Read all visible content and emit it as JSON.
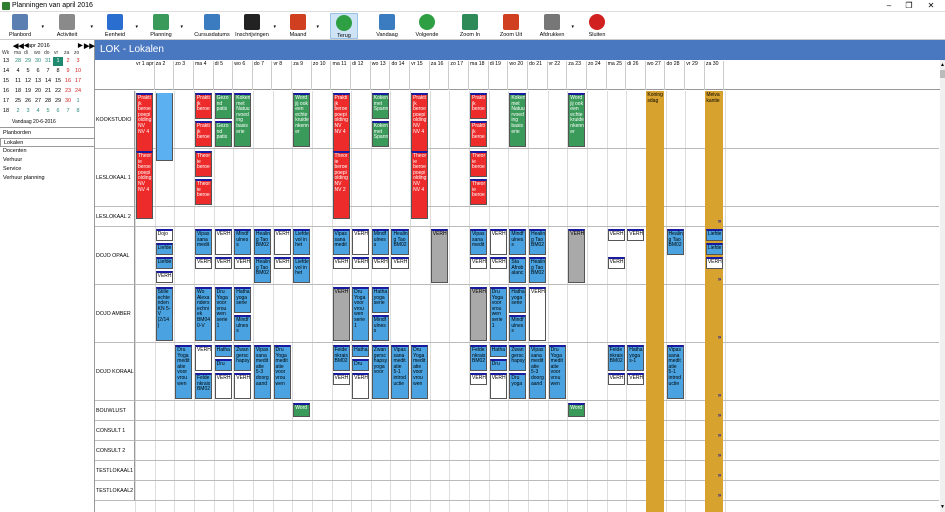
{
  "window": {
    "title": "Planningen van april 2016",
    "min": "–",
    "max": "❐",
    "close": "✕"
  },
  "toolbar": [
    {
      "label": "Planbord",
      "icon": "monitor-icon",
      "color": "#5a7fb0",
      "dd": true
    },
    {
      "label": "Activiteit",
      "icon": "gears-icon",
      "color": "#8a8a8a",
      "dd": true
    },
    {
      "label": "Eenheid",
      "icon": "cube-icon",
      "color": "#2a6fd0",
      "dd": true
    },
    {
      "label": "Planning",
      "icon": "chart-icon",
      "color": "#3a9a5a",
      "dd": true
    },
    {
      "label": "Cursusdatums",
      "icon": "calendar-grid-icon",
      "color": "#3b7bbf",
      "dd": false
    },
    {
      "label": "Inschrijvingen",
      "icon": "film-icon",
      "color": "#222222",
      "dd": true
    },
    {
      "label": "Maand",
      "icon": "calendar-icon",
      "color": "#d04020",
      "dd": true
    },
    {
      "label": "Terug",
      "icon": "back-arrow-icon",
      "color": "#2ea043",
      "dd": false
    },
    {
      "label": "Vandaag",
      "icon": "home-icon",
      "color": "#3b7bbf",
      "dd": false
    },
    {
      "label": "Volgende",
      "icon": "forward-arrow-icon",
      "color": "#2ea043",
      "dd": false
    },
    {
      "label": "Zoom In",
      "icon": "zoom-in-icon",
      "color": "#2e8b57",
      "dd": false
    },
    {
      "label": "Zoom Uit",
      "icon": "zoom-out-icon",
      "color": "#d04020",
      "dd": false
    },
    {
      "label": "Afdrukken",
      "icon": "printer-icon",
      "color": "#777777",
      "dd": true
    },
    {
      "label": "Sluiten",
      "icon": "power-icon",
      "color": "#d02020",
      "dd": false
    }
  ],
  "calendar": {
    "prev2": "◀◀",
    "prev": "◀",
    "next": "▶",
    "next2": "▶▶",
    "month": "apr 2016",
    "day_headers": [
      "Wk",
      "ma",
      "di",
      "wo",
      "do",
      "vr",
      "za",
      "zo"
    ],
    "weeks": [
      [
        "13",
        "28",
        "29",
        "30",
        "31",
        "1",
        "2",
        "3"
      ],
      [
        "14",
        "4",
        "5",
        "6",
        "7",
        "8",
        "9",
        "10"
      ],
      [
        "15",
        "11",
        "12",
        "13",
        "14",
        "15",
        "16",
        "17"
      ],
      [
        "16",
        "18",
        "19",
        "20",
        "21",
        "22",
        "23",
        "24"
      ],
      [
        "17",
        "25",
        "26",
        "27",
        "28",
        "29",
        "30",
        "1"
      ],
      [
        "18",
        "2",
        "3",
        "4",
        "5",
        "6",
        "7",
        "8"
      ]
    ],
    "today": "Vandaag 20-6-2016"
  },
  "menu": [
    "Planborden",
    "Lokalen",
    "Docenten",
    "Verhuur",
    "Service",
    "Verhuur planning"
  ],
  "header": {
    "title": "LOK - Lokalen"
  },
  "days": [
    "vr 1 apr",
    "za 2",
    "zo 3",
    "ma 4",
    "di 5",
    "wo 6",
    "do 7",
    "vr 8",
    "za 9",
    "zo 10",
    "ma 11",
    "di 12",
    "wo 13",
    "do 14",
    "vr 15",
    "za 16",
    "zo 17",
    "ma 18",
    "di 19",
    "wo 20",
    "do 21",
    "vr 22",
    "za 23",
    "zo 24",
    "ma 25",
    "di 26",
    "wo 27",
    "do 28",
    "vr 29",
    "za 30"
  ],
  "rooms": [
    "KOOKSTUDIO",
    "LESLOKAAL 1",
    "LESLOKAAL 2",
    "DOJO OPAAL",
    "DOJO AMBER",
    "DOJO KORAAL",
    "BOUWLUST",
    "CONSULT 1",
    "CONSULT 2",
    "TESTLOKAAL1",
    "TESTLOKAAL2"
  ],
  "holidays": [
    {
      "day": 26,
      "text": "Koning sdag"
    },
    {
      "day": 29,
      "text": "Meiva kantie"
    }
  ],
  "events": [
    {
      "d": 0,
      "r": 0,
      "t": "red",
      "s": 0,
      "h": 5,
      "txt": "Prakti jk beroe poepi olding NV NV 4"
    },
    {
      "d": 1,
      "r": 0,
      "t": "ltblue",
      "s": 0,
      "h": 5,
      "txt": ""
    },
    {
      "d": 3,
      "r": 0,
      "t": "red",
      "s": 0,
      "h": 2,
      "txt": "Prakti jk beroe"
    },
    {
      "d": 3,
      "r": 0,
      "t": "red",
      "s": 2,
      "h": 2,
      "txt": "Prakti jk beroe"
    },
    {
      "d": 4,
      "r": 0,
      "t": "green",
      "s": 0,
      "h": 2,
      "txt": "Gezo nd patis"
    },
    {
      "d": 4,
      "r": 0,
      "t": "green",
      "s": 2,
      "h": 2,
      "txt": "Gezo nd patis"
    },
    {
      "d": 5,
      "r": 0,
      "t": "green",
      "s": 0,
      "h": 4,
      "txt": "Koken met Natuu rvoed ing basis erie"
    },
    {
      "d": 8,
      "r": 0,
      "t": "green",
      "s": 0,
      "h": 4,
      "txt": "Word jij ook een echte kruide nkenn er"
    },
    {
      "d": 10,
      "r": 0,
      "t": "red",
      "s": 0,
      "h": 5,
      "txt": "Prakti jk beroe poepi olding NV NV 4"
    },
    {
      "d": 12,
      "r": 0,
      "t": "green",
      "s": 0,
      "h": 2,
      "txt": "Koken met Spann"
    },
    {
      "d": 12,
      "r": 0,
      "t": "green",
      "s": 2,
      "h": 2,
      "txt": "Koken met Spann"
    },
    {
      "d": 14,
      "r": 0,
      "t": "red",
      "s": 0,
      "h": 5,
      "txt": "Prakti jk beroe poepi olding NV NV 4"
    },
    {
      "d": 17,
      "r": 0,
      "t": "red",
      "s": 0,
      "h": 2,
      "txt": "Prakti jk beroe"
    },
    {
      "d": 17,
      "r": 0,
      "t": "red",
      "s": 2,
      "h": 2,
      "txt": "Prakti jk beroe"
    },
    {
      "d": 19,
      "r": 0,
      "t": "green",
      "s": 0,
      "h": 4,
      "txt": "Koken met Natuu rvoed ing basis erie"
    },
    {
      "d": 22,
      "r": 0,
      "t": "green",
      "s": 0,
      "h": 4,
      "txt": "Word jij ook een echte kruide nkenn er"
    },
    {
      "d": 0,
      "r": 1,
      "t": "red",
      "s": 0,
      "h": 5,
      "txt": "Theor ie beroe poepi olding NV NV 4"
    },
    {
      "d": 3,
      "r": 1,
      "t": "red",
      "s": 0,
      "h": 2,
      "txt": "Theor ie beroe"
    },
    {
      "d": 3,
      "r": 1,
      "t": "red",
      "s": 2,
      "h": 2,
      "txt": "Theor ie beroe"
    },
    {
      "d": 10,
      "r": 1,
      "t": "red",
      "s": 0,
      "h": 5,
      "txt": "Theor ie beroe poepi olding NV NV 2"
    },
    {
      "d": 14,
      "r": 1,
      "t": "red",
      "s": 0,
      "h": 5,
      "txt": "Theor ie beroe poepi olding NV NV 4"
    },
    {
      "d": 17,
      "r": 1,
      "t": "red",
      "s": 0,
      "h": 2,
      "txt": "Theor ie beroe"
    },
    {
      "d": 17,
      "r": 1,
      "t": "red",
      "s": 2,
      "h": 2,
      "txt": "Theor ie beroe"
    },
    {
      "d": 1,
      "r": 3,
      "t": "white",
      "s": 0,
      "h": 1,
      "txt": "Dojo"
    },
    {
      "d": 1,
      "r": 3,
      "t": "blue",
      "s": 1,
      "h": 1,
      "txt": "Liefde"
    },
    {
      "d": 1,
      "r": 3,
      "t": "blue",
      "s": 2,
      "h": 1,
      "txt": "Liefde"
    },
    {
      "d": 1,
      "r": 3,
      "t": "white",
      "s": 3,
      "h": 1,
      "txt": "VERH"
    },
    {
      "d": 3,
      "r": 3,
      "t": "blue",
      "s": 0,
      "h": 2,
      "txt": "Vipas sana medit"
    },
    {
      "d": 3,
      "r": 3,
      "t": "white",
      "s": 2,
      "h": 1,
      "txt": "VERH"
    },
    {
      "d": 4,
      "r": 3,
      "t": "white",
      "s": 0,
      "h": 2,
      "txt": "VERH"
    },
    {
      "d": 4,
      "r": 3,
      "t": "white",
      "s": 2,
      "h": 1,
      "txt": "VERH"
    },
    {
      "d": 5,
      "r": 3,
      "t": "blue",
      "s": 0,
      "h": 2,
      "txt": "Mindf ulnes s"
    },
    {
      "d": 5,
      "r": 3,
      "t": "white",
      "s": 2,
      "h": 1,
      "txt": "VERH"
    },
    {
      "d": 6,
      "r": 3,
      "t": "blue",
      "s": 0,
      "h": 2,
      "txt": "Healin g Tao BM02"
    },
    {
      "d": 6,
      "r": 3,
      "t": "blue",
      "s": 2,
      "h": 2,
      "txt": "Healin g Tao BM02"
    },
    {
      "d": 7,
      "r": 3,
      "t": "white",
      "s": 0,
      "h": 2,
      "txt": "VERH"
    },
    {
      "d": 7,
      "r": 3,
      "t": "white",
      "s": 2,
      "h": 1,
      "txt": "VERH"
    },
    {
      "d": 8,
      "r": 3,
      "t": "blue",
      "s": 0,
      "h": 2,
      "txt": "Liefde vol in het"
    },
    {
      "d": 8,
      "r": 3,
      "t": "blue",
      "s": 2,
      "h": 2,
      "txt": "Liefde vol in het"
    },
    {
      "d": 10,
      "r": 3,
      "t": "blue",
      "s": 0,
      "h": 2,
      "txt": "Vipas sana medit"
    },
    {
      "d": 10,
      "r": 3,
      "t": "white",
      "s": 2,
      "h": 1,
      "txt": "VERH"
    },
    {
      "d": 11,
      "r": 3,
      "t": "white",
      "s": 0,
      "h": 2,
      "txt": "VERH"
    },
    {
      "d": 11,
      "r": 3,
      "t": "white",
      "s": 2,
      "h": 1,
      "txt": "VERH"
    },
    {
      "d": 12,
      "r": 3,
      "t": "blue",
      "s": 0,
      "h": 2,
      "txt": "Mindf ulnes s"
    },
    {
      "d": 12,
      "r": 3,
      "t": "white",
      "s": 2,
      "h": 1,
      "txt": "VERH"
    },
    {
      "d": 13,
      "r": 3,
      "t": "blue",
      "s": 0,
      "h": 2,
      "txt": "Healin g Tao BM02"
    },
    {
      "d": 13,
      "r": 3,
      "t": "white",
      "s": 2,
      "h": 1,
      "txt": "VERH"
    },
    {
      "d": 15,
      "r": 3,
      "t": "gray",
      "s": 0,
      "h": 4,
      "txt": "VERH"
    },
    {
      "d": 17,
      "r": 3,
      "t": "blue",
      "s": 0,
      "h": 2,
      "txt": "Vipas sana medit"
    },
    {
      "d": 17,
      "r": 3,
      "t": "white",
      "s": 2,
      "h": 1,
      "txt": "VERH"
    },
    {
      "d": 18,
      "r": 3,
      "t": "white",
      "s": 0,
      "h": 2,
      "txt": "VERH"
    },
    {
      "d": 18,
      "r": 3,
      "t": "white",
      "s": 2,
      "h": 1,
      "txt": "VERH"
    },
    {
      "d": 19,
      "r": 3,
      "t": "blue",
      "s": 0,
      "h": 2,
      "txt": "Mindf ulnes s"
    },
    {
      "d": 19,
      "r": 3,
      "t": "blue",
      "s": 2,
      "h": 2,
      "txt": "Sta Afrob alanc"
    },
    {
      "d": 20,
      "r": 3,
      "t": "blue",
      "s": 0,
      "h": 2,
      "txt": "Healin g Tao BM02"
    },
    {
      "d": 20,
      "r": 3,
      "t": "blue",
      "s": 2,
      "h": 2,
      "txt": "Healin g Tao BM02"
    },
    {
      "d": 22,
      "r": 3,
      "t": "gray",
      "s": 0,
      "h": 4,
      "txt": "VERH"
    },
    {
      "d": 24,
      "r": 3,
      "t": "white",
      "s": 0,
      "h": 1,
      "txt": "VERH"
    },
    {
      "d": 24,
      "r": 3,
      "t": "white",
      "s": 2,
      "h": 1,
      "txt": "VERH"
    },
    {
      "d": 25,
      "r": 3,
      "t": "white",
      "s": 0,
      "h": 1,
      "txt": "VERH"
    },
    {
      "d": 27,
      "r": 3,
      "t": "blue",
      "s": 0,
      "h": 2,
      "txt": "Healin g Tao BM02"
    },
    {
      "d": 29,
      "r": 3,
      "t": "blue",
      "s": 0,
      "h": 1,
      "txt": "Liefde"
    },
    {
      "d": 29,
      "r": 3,
      "t": "blue",
      "s": 1,
      "h": 1,
      "txt": "Liefde"
    },
    {
      "d": 29,
      "r": 3,
      "t": "white",
      "s": 2,
      "h": 1,
      "txt": "VERH"
    },
    {
      "d": 1,
      "r": 4,
      "t": "blue",
      "s": 0,
      "h": 4,
      "txt": "Stille echte nden KN 5-V (2/14 )"
    },
    {
      "d": 3,
      "r": 4,
      "t": "blue",
      "s": 0,
      "h": 4,
      "txt": "Wo Alexa nders echni ek BM04 0-V"
    },
    {
      "d": 4,
      "r": 4,
      "t": "blue",
      "s": 0,
      "h": 4,
      "txt": "Dru Yoga voor vrou wen serie 1"
    },
    {
      "d": 5,
      "r": 4,
      "t": "blue",
      "s": 0,
      "h": 2,
      "txt": "Hatha yoga serie"
    },
    {
      "d": 5,
      "r": 4,
      "t": "blue",
      "s": 2,
      "h": 2,
      "txt": "Mindf ulnes s"
    },
    {
      "d": 10,
      "r": 4,
      "t": "gray",
      "s": 0,
      "h": 4,
      "txt": "VERH"
    },
    {
      "d": 11,
      "r": 4,
      "t": "blue",
      "s": 0,
      "h": 4,
      "txt": "Dru Yoga voor vrou wen serie 1"
    },
    {
      "d": 12,
      "r": 4,
      "t": "blue",
      "s": 0,
      "h": 2,
      "txt": "Hatha yoga serie"
    },
    {
      "d": 12,
      "r": 4,
      "t": "blue",
      "s": 2,
      "h": 2,
      "txt": "Mindf ulnes s"
    },
    {
      "d": 17,
      "r": 4,
      "t": "gray",
      "s": 0,
      "h": 4,
      "txt": "VERH"
    },
    {
      "d": 18,
      "r": 4,
      "t": "blue",
      "s": 0,
      "h": 4,
      "txt": "Dru Yoga voor vrou wen serie 1"
    },
    {
      "d": 19,
      "r": 4,
      "t": "blue",
      "s": 0,
      "h": 2,
      "txt": "Hatha yoga serie"
    },
    {
      "d": 19,
      "r": 4,
      "t": "blue",
      "s": 2,
      "h": 2,
      "txt": "Mindf ulnes s"
    },
    {
      "d": 20,
      "r": 4,
      "t": "white",
      "s": 0,
      "h": 4,
      "txt": "VERH"
    },
    {
      "d": 2,
      "r": 5,
      "t": "blue",
      "s": 0,
      "h": 4,
      "txt": "Dru Yoga medit atie voor vrou wen"
    },
    {
      "d": 3,
      "r": 5,
      "t": "white",
      "s": 0,
      "h": 2,
      "txt": "VERH"
    },
    {
      "d": 3,
      "r": 5,
      "t": "blue",
      "s": 2,
      "h": 2,
      "txt": "Felde nkrais BM02"
    },
    {
      "d": 4,
      "r": 5,
      "t": "blue",
      "s": 0,
      "h": 1,
      "txt": "Hatha"
    },
    {
      "d": 4,
      "r": 5,
      "t": "blue",
      "s": 1,
      "h": 1,
      "txt": "Dru"
    },
    {
      "d": 4,
      "r": 5,
      "t": "white",
      "s": 2,
      "h": 2,
      "txt": "VERH"
    },
    {
      "d": 5,
      "r": 5,
      "t": "blue",
      "s": 0,
      "h": 2,
      "txt": "Zwan gersc hapsy"
    },
    {
      "d": 5,
      "r": 5,
      "t": "white",
      "s": 2,
      "h": 2,
      "txt": "VERH"
    },
    {
      "d": 6,
      "r": 5,
      "t": "blue",
      "s": 0,
      "h": 4,
      "txt": "Vipas sana medit atie 5-3 doorg aand"
    },
    {
      "d": 7,
      "r": 5,
      "t": "blue",
      "s": 0,
      "h": 4,
      "txt": "Dru Yoga medit atie voor vrou wen"
    },
    {
      "d": 10,
      "r": 5,
      "t": "blue",
      "s": 0,
      "h": 2,
      "txt": "Felde nkrais BM02"
    },
    {
      "d": 10,
      "r": 5,
      "t": "white",
      "s": 2,
      "h": 1,
      "txt": "VERH"
    },
    {
      "d": 11,
      "r": 5,
      "t": "blue",
      "s": 0,
      "h": 1,
      "txt": "Hatha"
    },
    {
      "d": 11,
      "r": 5,
      "t": "blue",
      "s": 1,
      "h": 1,
      "txt": "Dru"
    },
    {
      "d": 11,
      "r": 5,
      "t": "white",
      "s": 2,
      "h": 2,
      "txt": "VERH"
    },
    {
      "d": 12,
      "r": 5,
      "t": "blue",
      "s": 0,
      "h": 4,
      "txt": "Zwan gersc hapsy yoga voor"
    },
    {
      "d": 13,
      "r": 5,
      "t": "blue",
      "s": 0,
      "h": 4,
      "txt": "Vipas sana medit atie 5-1 introd uctie"
    },
    {
      "d": 14,
      "r": 5,
      "t": "blue",
      "s": 0,
      "h": 4,
      "txt": "Dru Yoga medit atie voor vrou wen"
    },
    {
      "d": 17,
      "r": 5,
      "t": "blue",
      "s": 0,
      "h": 2,
      "txt": "Felde nkrais BM02"
    },
    {
      "d": 17,
      "r": 5,
      "t": "white",
      "s": 2,
      "h": 1,
      "txt": "VERH"
    },
    {
      "d": 18,
      "r": 5,
      "t": "blue",
      "s": 0,
      "h": 1,
      "txt": "Hatha"
    },
    {
      "d": 18,
      "r": 5,
      "t": "blue",
      "s": 1,
      "h": 1,
      "txt": "Dru"
    },
    {
      "d": 18,
      "r": 5,
      "t": "white",
      "s": 2,
      "h": 2,
      "txt": "VERH"
    },
    {
      "d": 19,
      "r": 5,
      "t": "blue",
      "s": 0,
      "h": 2,
      "txt": "Zwan gersc hapsy"
    },
    {
      "d": 19,
      "r": 5,
      "t": "blue",
      "s": 2,
      "h": 2,
      "txt": "Dru yoga"
    },
    {
      "d": 20,
      "r": 5,
      "t": "blue",
      "s": 0,
      "h": 4,
      "txt": "Vipas sana medit atie 5-3 doorg aand"
    },
    {
      "d": 21,
      "r": 5,
      "t": "blue",
      "s": 0,
      "h": 4,
      "txt": "Dru Yoga medit atie voor vrou wen"
    },
    {
      "d": 24,
      "r": 5,
      "t": "blue",
      "s": 0,
      "h": 2,
      "txt": "Felde nkrais BM02"
    },
    {
      "d": 24,
      "r": 5,
      "t": "white",
      "s": 2,
      "h": 1,
      "txt": "VERH"
    },
    {
      "d": 25,
      "r": 5,
      "t": "blue",
      "s": 0,
      "h": 2,
      "txt": "Hatha yoga s-1"
    },
    {
      "d": 25,
      "r": 5,
      "t": "white",
      "s": 2,
      "h": 1,
      "txt": "VERH"
    },
    {
      "d": 27,
      "r": 5,
      "t": "blue",
      "s": 0,
      "h": 4,
      "txt": "Vipas sana medit atie 5-1 introd uctie"
    },
    {
      "d": 8,
      "r": 6,
      "t": "green",
      "s": 0,
      "h": 1,
      "txt": "Word"
    },
    {
      "d": 22,
      "r": 6,
      "t": "green",
      "s": 0,
      "h": 1,
      "txt": "Word"
    }
  ],
  "more_marker": "»"
}
